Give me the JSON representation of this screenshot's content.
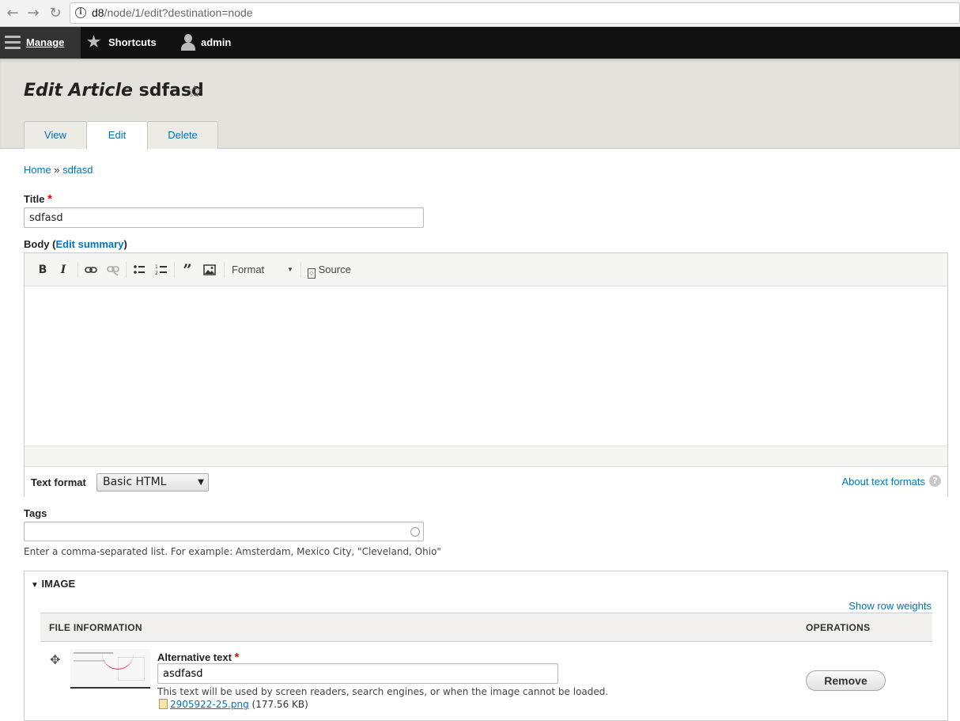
{
  "browser": {
    "url_host": "d8",
    "url_path": "/node/1/edit?destination=node",
    "back_icon": "arrow-left-icon",
    "forward_icon": "arrow-right-icon",
    "reload_icon": "reload-icon"
  },
  "toolbar": {
    "manage_label": "Manage",
    "shortcuts_label": "Shortcuts",
    "user_label": "admin"
  },
  "header": {
    "title_prefix": "Edit Article",
    "title_node": "sdfasd",
    "tabs": [
      {
        "label": "View"
      },
      {
        "label": "Edit"
      },
      {
        "label": "Delete"
      }
    ]
  },
  "breadcrumb": {
    "home": "Home",
    "separator": " » ",
    "current": "sdfasd"
  },
  "title_field": {
    "label": "Title",
    "required_mark": "*",
    "value": "sdfasd"
  },
  "body_field": {
    "label": "Body",
    "open_paren": " (",
    "edit_summary": "Edit summary",
    "close_paren": ")",
    "editor_buttons": {
      "bold": "B",
      "italic": "I",
      "format": "Format",
      "source": "Source"
    },
    "text_format_label": "Text format",
    "text_format_value": "Basic HTML",
    "about_link": "About text formats",
    "help": "?"
  },
  "tags_field": {
    "label": "Tags",
    "value": "",
    "description": "Enter a comma-separated list. For example: Amsterdam, Mexico City, \"Cleveland, Ohio\""
  },
  "image_fieldset": {
    "legend": "IMAGE",
    "show_row_weights": "Show row weights",
    "columns": [
      "FILE INFORMATION",
      "OPERATIONS"
    ],
    "row": {
      "alt_label": "Alternative text",
      "alt_value": "asdfasd",
      "alt_description": "This text will be used by screen readers, search engines, or when the image cannot be loaded.",
      "file_name": "2905922-25.png",
      "file_size": "(177.56 KB)",
      "remove_label": "Remove"
    }
  },
  "colors": {
    "toolbar_bg": "#111111",
    "header_bg": "#e4e2dc",
    "link": "#0074bd",
    "required": "#ee0000"
  }
}
